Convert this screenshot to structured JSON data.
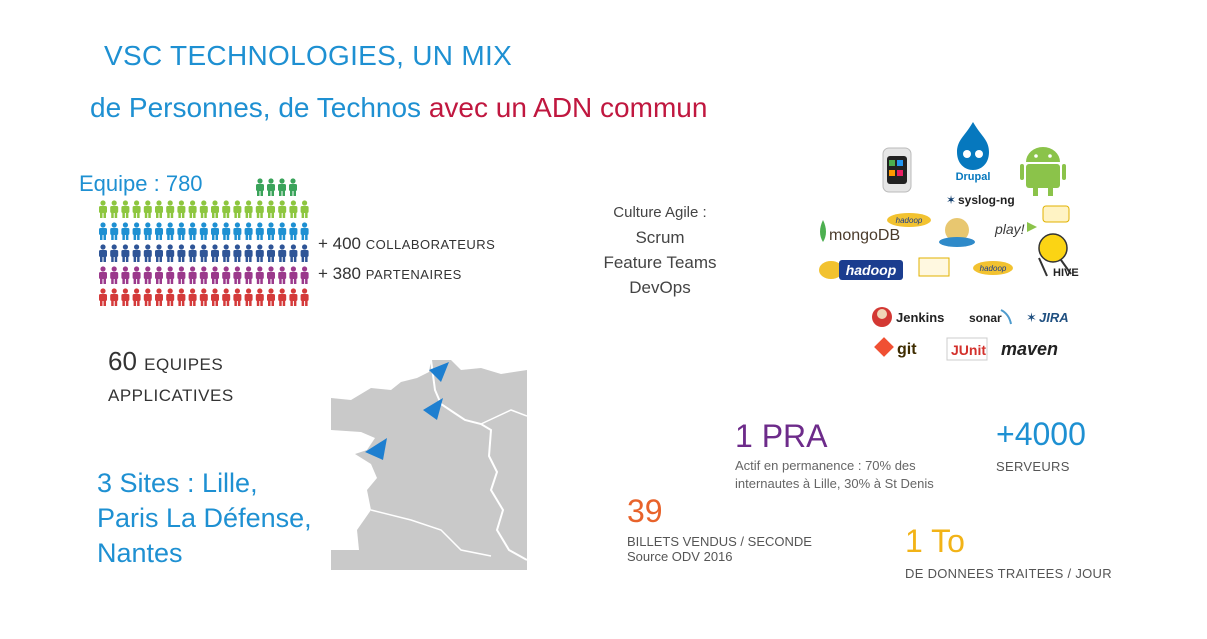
{
  "title": "VSC TECHNOLOGIES, UN MIX",
  "subtitle": {
    "part1": "de Personnes, de Technos ",
    "part2": "avec un ADN commun"
  },
  "team": {
    "label": "Equipe : 780",
    "collab_num": "+ 400 ",
    "collab_text": "COLLABORATEURS",
    "partner_num": "+ 380 ",
    "partner_text": "PARTENAIRES",
    "colors": [
      "#3aa35a",
      "#8dc63f",
      "#1e90d2",
      "#2f5597",
      "#9b3a8c",
      "#d43a3a"
    ]
  },
  "culture": {
    "line1": "Culture Agile :",
    "line2": "Scrum",
    "line3": "Feature Teams",
    "line4": "DevOps"
  },
  "logos": {
    "drupal": "Drupal",
    "syslog": "syslog-ng",
    "mongodb": "mongoDB",
    "play": "play!",
    "hadoop": "hadoop",
    "hive": "HIVE",
    "jenkins": "Jenkins",
    "sonar": "sonar",
    "jira": "JIRA",
    "git": "git",
    "junit": "JUnit",
    "maven": "maven"
  },
  "equipes": {
    "num": "60 ",
    "word": "EQUIPES",
    "line2": "APPLICATIVES"
  },
  "sites": {
    "line1": "3 Sites : Lille,",
    "line2": "Paris La Défense,",
    "line3": "Nantes"
  },
  "pra": {
    "num": "1 PRA",
    "line1": "Actif en permanence : 70% des",
    "line2": "internautes à Lille, 30% à St Denis"
  },
  "serveurs": {
    "num": "+4000",
    "text": "SERVEURS"
  },
  "billets": {
    "num": "39",
    "line1": "BILLETS VENDUS / SECONDE",
    "line2": "Source ODV 2016"
  },
  "donnees": {
    "num": "1 To",
    "text": "DE DONNEES TRAITEES / JOUR"
  }
}
